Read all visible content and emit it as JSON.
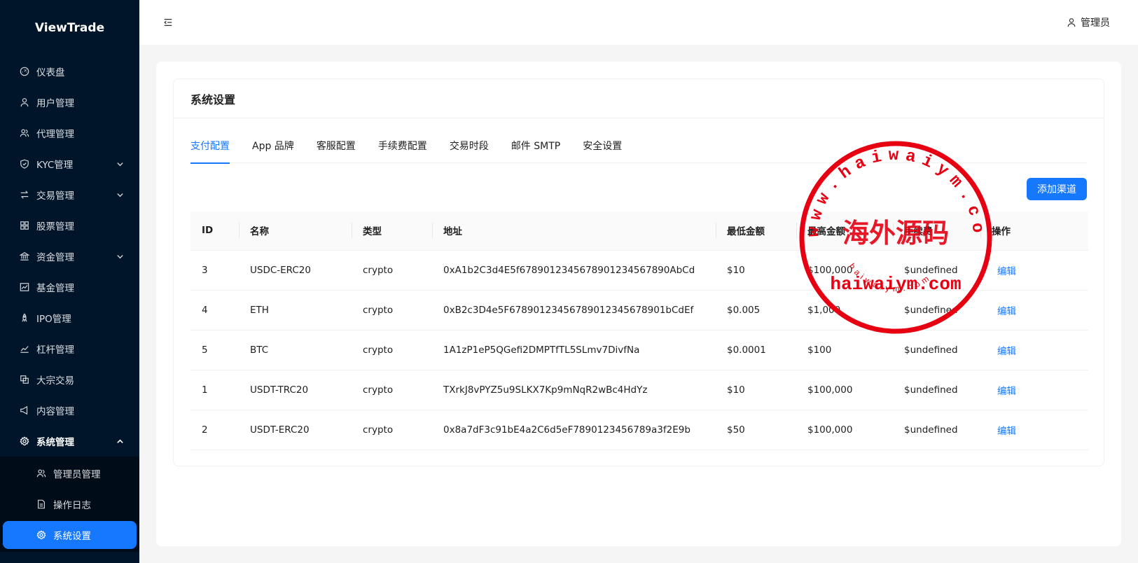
{
  "app": {
    "brand": "ViewTrade"
  },
  "sidebar": {
    "items": [
      {
        "label": "仪表盘",
        "icon": "dashboard-icon"
      },
      {
        "label": "用户管理",
        "icon": "user-icon"
      },
      {
        "label": "代理管理",
        "icon": "team-icon"
      },
      {
        "label": "KYC管理",
        "icon": "shield-icon",
        "expandable": true
      },
      {
        "label": "交易管理",
        "icon": "swap-icon",
        "expandable": true
      },
      {
        "label": "股票管理",
        "icon": "grid-icon"
      },
      {
        "label": "资金管理",
        "icon": "bank-icon",
        "expandable": true
      },
      {
        "label": "基金管理",
        "icon": "fund-icon"
      },
      {
        "label": "IPO管理",
        "icon": "rocket-icon"
      },
      {
        "label": "杠杆管理",
        "icon": "line-chart-icon"
      },
      {
        "label": "大宗交易",
        "icon": "block-icon"
      },
      {
        "label": "内容管理",
        "icon": "notification-icon"
      },
      {
        "label": "系统管理",
        "icon": "setting-icon",
        "expandable": true,
        "open": true
      }
    ],
    "subitems": [
      {
        "label": "管理员管理",
        "icon": "team-icon"
      },
      {
        "label": "操作日志",
        "icon": "file-icon"
      },
      {
        "label": "系统设置",
        "icon": "setting-icon",
        "active": true
      }
    ]
  },
  "header": {
    "user": "管理员"
  },
  "page": {
    "title": "系统设置",
    "tabs": [
      "支付配置",
      "App 品牌",
      "客服配置",
      "手续费配置",
      "交易时段",
      "邮件 SMTP",
      "安全设置"
    ],
    "active_tab": 0,
    "add_button": "添加渠道"
  },
  "table": {
    "columns": [
      "ID",
      "名称",
      "类型",
      "地址",
      "最低金额",
      "最高金额",
      "手续费",
      "操作"
    ],
    "rows": [
      {
        "id": "3",
        "name": "USDC-ERC20",
        "type": "crypto",
        "address": "0xA1b2C3d4E5f6789012345678901234567890AbCd",
        "min": "$10",
        "max": "$100,000",
        "fee": "$undefined",
        "action": "编辑"
      },
      {
        "id": "4",
        "name": "ETH",
        "type": "crypto",
        "address": "0xB2c3D4e5F678901234567890123456789 01bCdEf",
        "min": "$0.005",
        "max": "$1,000",
        "fee": "$undefined",
        "action": "编辑"
      },
      {
        "id": "5",
        "name": "BTC",
        "type": "crypto",
        "address": "1A1zP1eP5QGefi2DMPTfTL5SLmv7DivfNa",
        "min": "$0.0001",
        "max": "$100",
        "fee": "$undefined",
        "action": "编辑"
      },
      {
        "id": "1",
        "name": "USDT-TRC20",
        "type": "crypto",
        "address": "TXrkJ8vPYZ5u9SLKX7Kp9mNqR2wBc4HdYz",
        "min": "$10",
        "max": "$100,000",
        "fee": "$undefined",
        "action": "编辑"
      },
      {
        "id": "2",
        "name": "USDT-ERC20",
        "type": "crypto",
        "address": "0x8a7dF3c91bE4a2C6d5eF7890123456789a3f2E9b",
        "min": "$50",
        "max": "$100,000",
        "fee": "$undefined",
        "action": "编辑"
      }
    ]
  },
  "watermark": {
    "ring_text": "www.haiwaiym.com",
    "center_text": "海外源码",
    "url_text": "haiwaiym.com",
    "bottom_text": "haiwaiym.com",
    "color": "#e60012"
  }
}
